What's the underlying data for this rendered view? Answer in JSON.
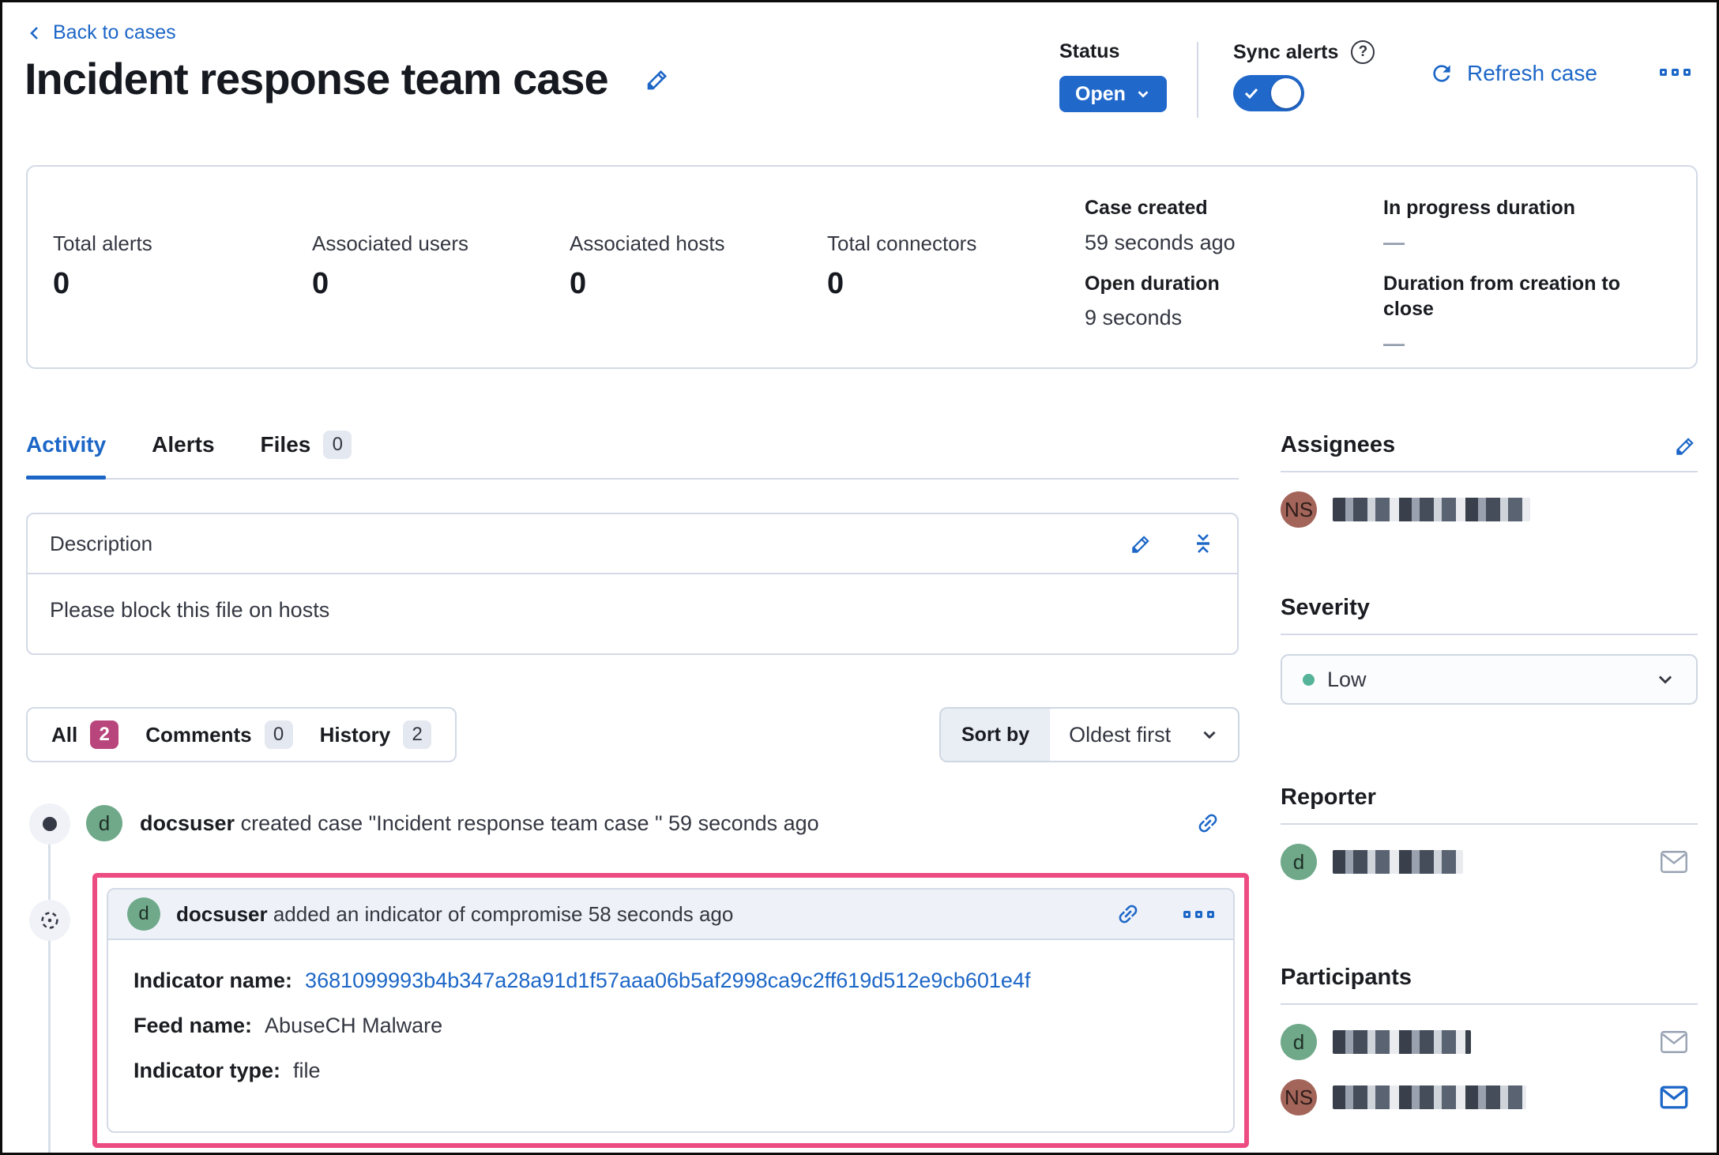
{
  "colors": {
    "accent_blue": "#1c66c7",
    "status_button_blue": "#2168cb",
    "highlight_pink": "#ed4c82",
    "badge_pink": "#b8457c",
    "avatar_green": "#6fa98a",
    "avatar_maroon": "#a3655a",
    "severity_low_green": "#54b399"
  },
  "header": {
    "back_link": "Back to cases",
    "title": "Incident response team case",
    "status": {
      "label": "Status",
      "value": "Open"
    },
    "sync_alerts": {
      "label": "Sync alerts",
      "help_glyph": "?"
    },
    "refresh_label": "Refresh case"
  },
  "stats": {
    "metrics": [
      {
        "label": "Total alerts",
        "value": "0"
      },
      {
        "label": "Associated users",
        "value": "0"
      },
      {
        "label": "Associated hosts",
        "value": "0"
      },
      {
        "label": "Total connectors",
        "value": "0"
      }
    ],
    "meta_left": [
      {
        "label": "Case created",
        "value": "59 seconds ago"
      },
      {
        "label": "Open duration",
        "value": "9 seconds"
      }
    ],
    "meta_right": [
      {
        "label": "In progress duration",
        "value": "—"
      },
      {
        "label": "Duration from creation to close",
        "value": "—"
      }
    ]
  },
  "tabs": [
    {
      "label": "Activity"
    },
    {
      "label": "Alerts"
    },
    {
      "label": "Files",
      "badge": "0"
    }
  ],
  "description": {
    "title": "Description",
    "body": "Please block this file on hosts"
  },
  "filters": [
    {
      "label": "All",
      "count": "2"
    },
    {
      "label": "Comments",
      "count": "0"
    },
    {
      "label": "History",
      "count": "2"
    }
  ],
  "sort": {
    "label": "Sort by",
    "value": "Oldest first"
  },
  "timeline": [
    {
      "avatar": "d",
      "user": "docsuser",
      "action": "created case \"Incident response team case \" 59 seconds ago"
    },
    {
      "avatar": "d",
      "user": "docsuser",
      "action": "added an indicator of compromise 58 seconds ago",
      "fields": [
        {
          "label": "Indicator name:",
          "value": "3681099993b4b347a28a91d1f57aaa06b5af2998ca9c2ff619d512e9cb601e4f"
        },
        {
          "label": "Feed name:",
          "value": "AbuseCH Malware"
        },
        {
          "label": "Indicator type:",
          "value": "file"
        }
      ]
    }
  ],
  "sidebar": {
    "assignees": {
      "title": "Assignees",
      "users": [
        {
          "initials": "NS"
        }
      ]
    },
    "severity": {
      "title": "Severity",
      "value": "Low"
    },
    "reporter": {
      "title": "Reporter",
      "users": [
        {
          "initials": "d"
        }
      ]
    },
    "participants": {
      "title": "Participants",
      "users": [
        {
          "initials": "d"
        },
        {
          "initials": "NS"
        }
      ]
    }
  }
}
